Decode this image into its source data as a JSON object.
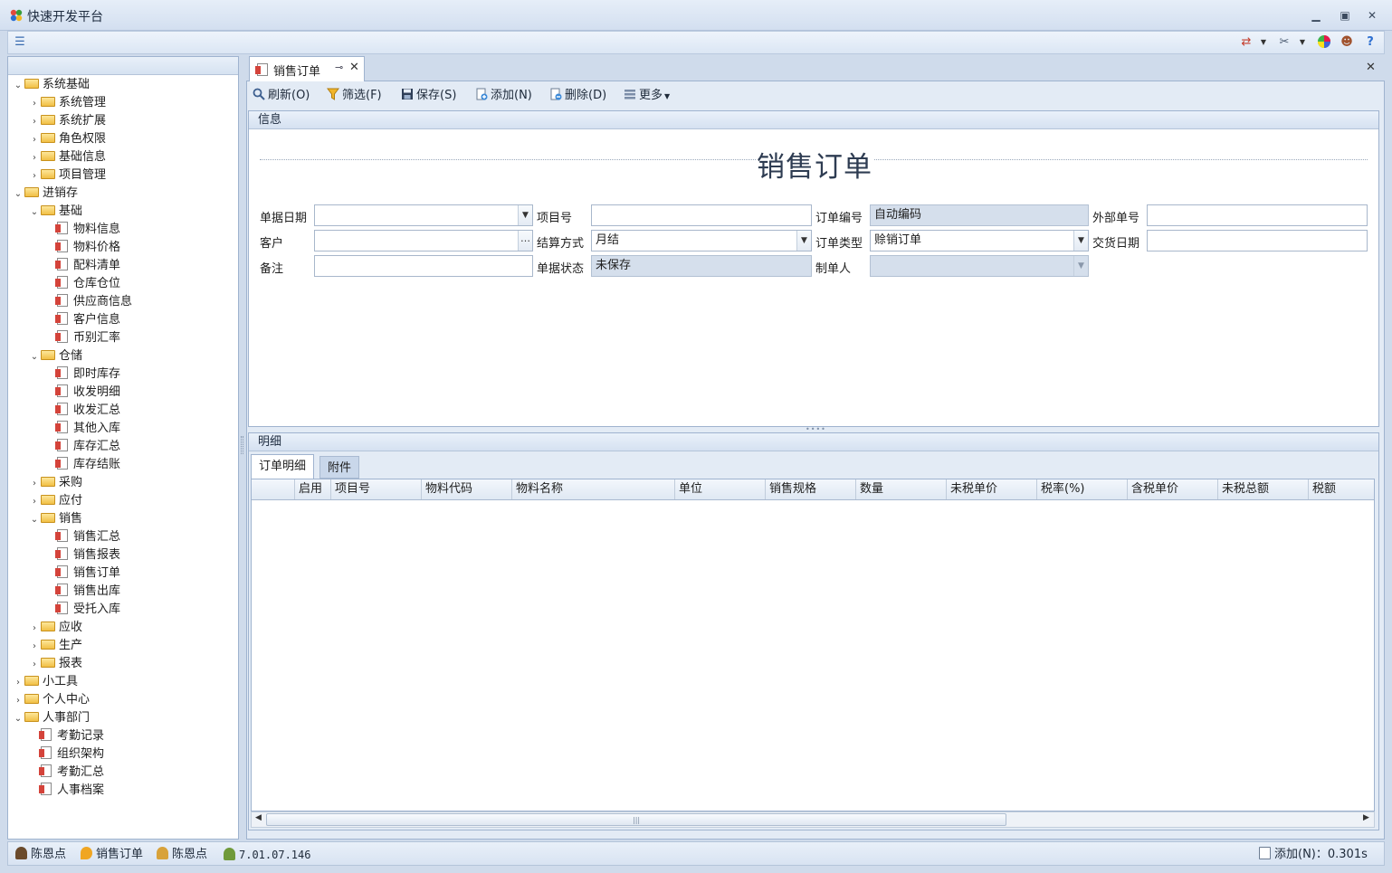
{
  "window": {
    "title": "快速开发平台"
  },
  "sidebar": {
    "tree": [
      {
        "label": "系统基础",
        "level": 0,
        "type": "folder",
        "expanded": true
      },
      {
        "label": "系统管理",
        "level": 1,
        "type": "folder",
        "expanded": false
      },
      {
        "label": "系统扩展",
        "level": 1,
        "type": "folder",
        "expanded": false
      },
      {
        "label": "角色权限",
        "level": 1,
        "type": "folder",
        "expanded": false
      },
      {
        "label": "基础信息",
        "level": 1,
        "type": "folder",
        "expanded": false
      },
      {
        "label": "项目管理",
        "level": 1,
        "type": "folder",
        "expanded": false
      },
      {
        "label": "进销存",
        "level": 0,
        "type": "folder",
        "expanded": true
      },
      {
        "label": "基础",
        "level": 1,
        "type": "folder",
        "expanded": true
      },
      {
        "label": "物料信息",
        "level": 2,
        "type": "doc"
      },
      {
        "label": "物料价格",
        "level": 2,
        "type": "doc"
      },
      {
        "label": "配料清单",
        "level": 2,
        "type": "doc"
      },
      {
        "label": "仓库仓位",
        "level": 2,
        "type": "doc"
      },
      {
        "label": "供应商信息",
        "level": 2,
        "type": "doc"
      },
      {
        "label": "客户信息",
        "level": 2,
        "type": "doc"
      },
      {
        "label": "币别汇率",
        "level": 2,
        "type": "doc"
      },
      {
        "label": "仓储",
        "level": 1,
        "type": "folder",
        "expanded": true
      },
      {
        "label": "即时库存",
        "level": 2,
        "type": "doc"
      },
      {
        "label": "收发明细",
        "level": 2,
        "type": "doc"
      },
      {
        "label": "收发汇总",
        "level": 2,
        "type": "doc"
      },
      {
        "label": "其他入库",
        "level": 2,
        "type": "doc"
      },
      {
        "label": "库存汇总",
        "level": 2,
        "type": "doc"
      },
      {
        "label": "库存结账",
        "level": 2,
        "type": "doc"
      },
      {
        "label": "采购",
        "level": 1,
        "type": "folder",
        "expanded": false
      },
      {
        "label": "应付",
        "level": 1,
        "type": "folder",
        "expanded": false
      },
      {
        "label": "销售",
        "level": 1,
        "type": "folder",
        "expanded": true
      },
      {
        "label": "销售汇总",
        "level": 2,
        "type": "doc"
      },
      {
        "label": "销售报表",
        "level": 2,
        "type": "doc"
      },
      {
        "label": "销售订单",
        "level": 2,
        "type": "doc"
      },
      {
        "label": "销售出库",
        "level": 2,
        "type": "doc"
      },
      {
        "label": "受托入库",
        "level": 2,
        "type": "doc"
      },
      {
        "label": "应收",
        "level": 1,
        "type": "folder",
        "expanded": false
      },
      {
        "label": "生产",
        "level": 1,
        "type": "folder",
        "expanded": false
      },
      {
        "label": "报表",
        "level": 1,
        "type": "folder",
        "expanded": false
      },
      {
        "label": "小工具",
        "level": 0,
        "type": "folder",
        "expanded": false
      },
      {
        "label": "个人中心",
        "level": 0,
        "type": "folder",
        "expanded": false
      },
      {
        "label": "人事部门",
        "level": 0,
        "type": "folder",
        "expanded": true
      },
      {
        "label": "考勤记录",
        "level": 1,
        "type": "doc"
      },
      {
        "label": "组织架构",
        "level": 1,
        "type": "doc"
      },
      {
        "label": "考勤汇总",
        "level": 1,
        "type": "doc"
      },
      {
        "label": "人事档案",
        "level": 1,
        "type": "doc"
      }
    ]
  },
  "tab": {
    "label": "销售订单"
  },
  "toolbar": {
    "refresh": "刷新(O)",
    "filter": "筛选(F)",
    "save": "保存(S)",
    "add": "添加(N)",
    "delete": "删除(D)",
    "more": "更多"
  },
  "info": {
    "group_title": "信息",
    "form_title": "销售订单",
    "labels": {
      "doc_date": "单据日期",
      "project_no": "项目号",
      "order_no": "订单编号",
      "external_no": "外部单号",
      "customer": "客户",
      "settlement": "结算方式",
      "order_type": "订单类型",
      "delivery_date": "交货日期",
      "remark": "备注",
      "doc_status": "单据状态",
      "maker": "制单人"
    },
    "values": {
      "doc_date": "",
      "project_no": "",
      "order_no": "自动编码",
      "external_no": "",
      "customer": "",
      "settlement": "月结",
      "order_type": "赊销订单",
      "delivery_date": "",
      "remark": "",
      "doc_status": "未保存",
      "maker": ""
    }
  },
  "detail": {
    "group_title": "明细",
    "tabs": [
      "订单明细",
      "附件"
    ],
    "columns": [
      "启用",
      "项目号",
      "物料代码",
      "物料名称",
      "单位",
      "销售规格",
      "数量",
      "未税单价",
      "税率(%)",
      "含税单价",
      "未税总额",
      "税额"
    ]
  },
  "status": {
    "user": "陈恩点",
    "page": "销售订单",
    "user2": "陈恩点",
    "version": "7.01.07.146",
    "last_action": "添加(N)：0.301s"
  }
}
